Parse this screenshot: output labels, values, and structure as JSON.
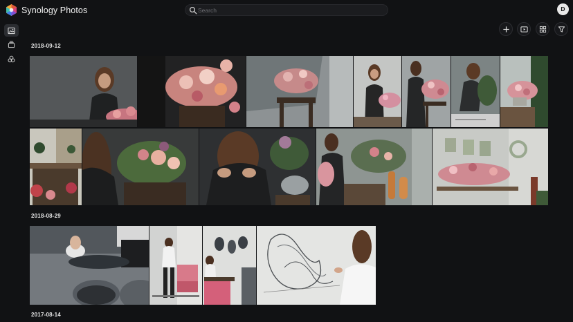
{
  "app": {
    "title": "Synology Photos"
  },
  "search": {
    "placeholder": "Search"
  },
  "user": {
    "avatar_initial": "D"
  },
  "sidebar": {
    "items": [
      {
        "icon": "photos-icon",
        "active": true
      },
      {
        "icon": "album-icon",
        "active": false
      },
      {
        "icon": "shared-space-icon",
        "active": false
      }
    ]
  },
  "toolbar": {
    "items": [
      "add-icon",
      "slideshow-icon",
      "grid-view-icon",
      "filter-icon"
    ]
  },
  "groups": [
    {
      "date": "2018-09-12",
      "photo_count": 13
    },
    {
      "date": "2018-08-29",
      "photo_count": 4
    },
    {
      "date": "2017-08-14",
      "photo_count": 0
    }
  ]
}
